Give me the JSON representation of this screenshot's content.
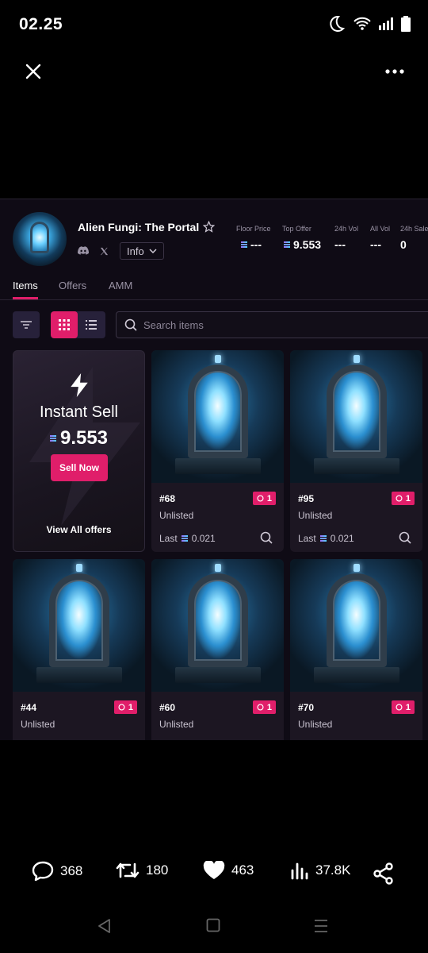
{
  "status_bar": {
    "time": "02.25"
  },
  "collection": {
    "name": "Alien Fungi: The Portal",
    "info_label": "Info",
    "stats": [
      {
        "label": "Floor Price",
        "value": "---",
        "sol": true
      },
      {
        "label": "Top Offer",
        "value": "9.553",
        "sol": true
      },
      {
        "label": "24h Vol",
        "value": "---",
        "sol": false
      },
      {
        "label": "All Vol",
        "value": "---",
        "sol": false
      },
      {
        "label": "24h Sale",
        "value": "0",
        "sol": false
      }
    ]
  },
  "tabs": [
    "Items",
    "Offers",
    "AMM"
  ],
  "search": {
    "placeholder": "Search items"
  },
  "instant_sell": {
    "title": "Instant Sell",
    "price": "9.553",
    "button": "Sell Now",
    "view_all": "View All offers"
  },
  "nfts": [
    {
      "id": "#68",
      "offers": "1",
      "status": "Unlisted",
      "last_label": "Last",
      "last_price": "0.021"
    },
    {
      "id": "#95",
      "offers": "1",
      "status": "Unlisted",
      "last_label": "Last",
      "last_price": "0.021"
    },
    {
      "id": "#44",
      "offers": "1",
      "status": "Unlisted"
    },
    {
      "id": "#60",
      "offers": "1",
      "status": "Unlisted"
    },
    {
      "id": "#70",
      "offers": "1",
      "status": "Unlisted"
    }
  ],
  "engagement": {
    "replies": "368",
    "reposts": "180",
    "likes": "463",
    "views": "37.8K"
  },
  "colors": {
    "accent": "#e01e6a",
    "panel_bg": "#0f0b15",
    "card_bg": "#1c1622"
  }
}
